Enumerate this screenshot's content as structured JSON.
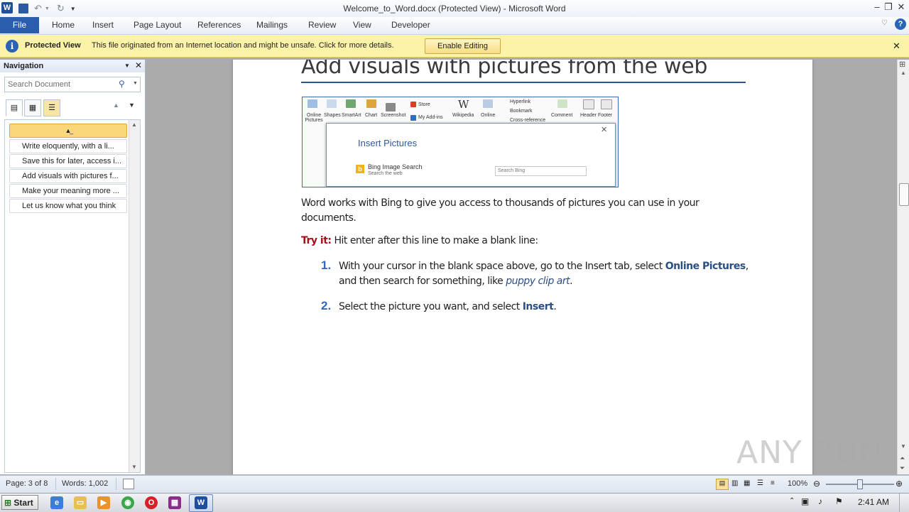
{
  "window": {
    "title": "Welcome_to_Word.docx (Protected View)  -  Microsoft Word"
  },
  "ribbon": {
    "file_tab": "File",
    "tabs": [
      "Home",
      "Insert",
      "Page Layout",
      "References",
      "Mailings",
      "Review",
      "View",
      "Developer"
    ]
  },
  "protected_bar": {
    "title": "Protected View",
    "message": "This file originated from an Internet location and might be unsafe. Click for more details.",
    "enable_button": "Enable Editing"
  },
  "navigation": {
    "title": "Navigation",
    "search_placeholder": "Search Document",
    "items": [
      "Write eloquently, with a li...",
      "Save this for later, access i...",
      "Add visuals with pictures f...",
      "Make your meaning more ...",
      "Let us know what you think"
    ]
  },
  "document": {
    "heading": "Add visuals with pictures from the web",
    "screenshot": {
      "buttons": [
        "Online Pictures",
        "Shapes",
        "SmartArt",
        "Chart",
        "Screenshot",
        "Store",
        "My Add-ins",
        "Wikipedia",
        "Online",
        "Hyperlink",
        "Bookmark",
        "Cross-reference",
        "Comment",
        "Header",
        "Footer"
      ],
      "dialog_title": "Insert Pictures",
      "bing_title": "Bing Image Search",
      "bing_subtitle": "Search the web",
      "search_placeholder": "Search Bing"
    },
    "para1": "Word works with Bing to give you access to thousands of pictures you can use in your documents.",
    "tryit_label": "Try it:",
    "tryit_text": " Hit enter after this line to make a blank line:",
    "step1_num": "1.",
    "step1_a": "With your cursor in the blank space above, go to the Insert tab, select ",
    "step1_b": "Online Pictures",
    "step1_c": ",",
    "step1_d": "and then search for something, like ",
    "step1_e": "puppy clip art",
    "step1_f": ".",
    "step2_num": "2.",
    "step2_a": "Select the picture you want, and select ",
    "step2_b": "Insert",
    "step2_c": "."
  },
  "statusbar": {
    "page": "Page: 3 of 8",
    "words": "Words: 1,002",
    "zoom": "100%"
  },
  "taskbar": {
    "start": "Start",
    "clock": "2:41 AM"
  },
  "watermark": "ANY RUN"
}
